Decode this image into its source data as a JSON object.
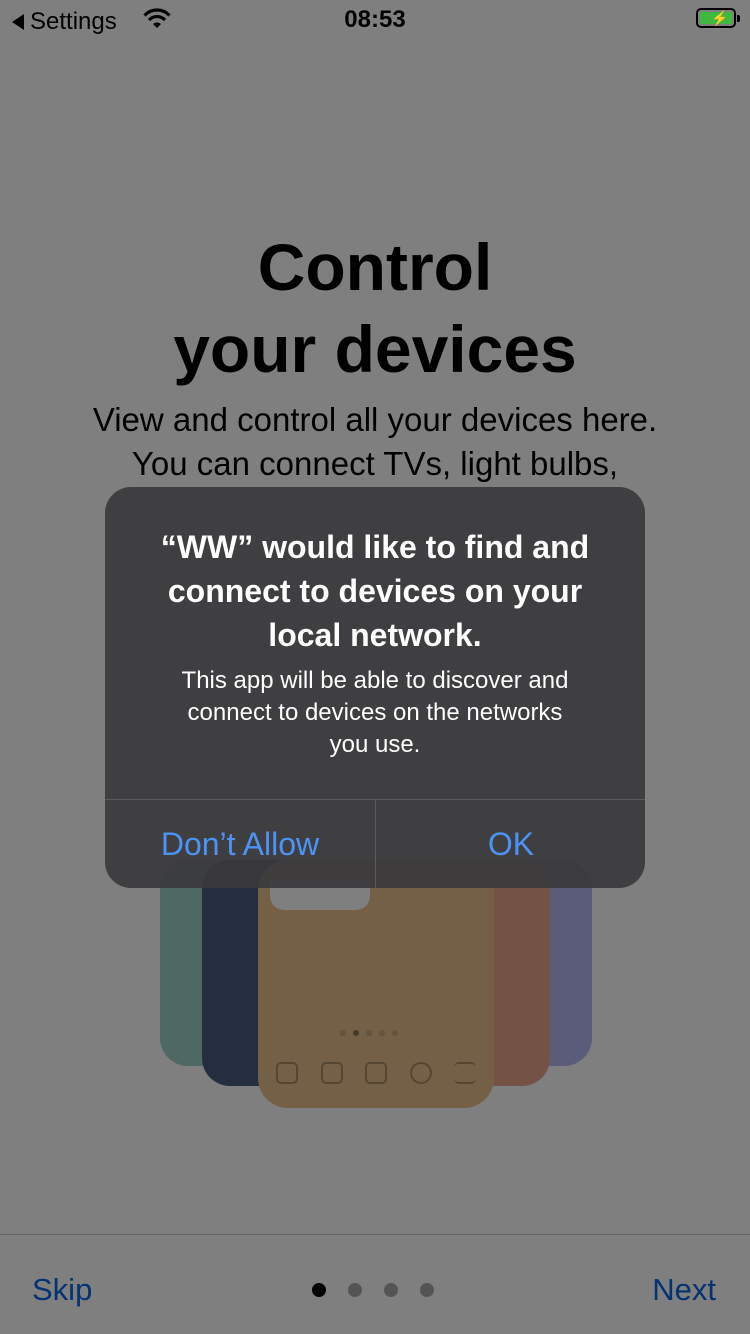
{
  "status_bar": {
    "back_label": "Settings",
    "time": "08:53",
    "battery_color": "#3fb83f",
    "icons": [
      "back-triangle-icon",
      "wifi-icon",
      "battery-charging-icon"
    ]
  },
  "onboarding": {
    "title_lines": [
      "Control",
      "your devices"
    ],
    "subtitle_lines": [
      "View and control all your devices here.",
      "You can connect TVs, light bulbs,"
    ],
    "page_count": 4,
    "current_page": 1
  },
  "bottom_bar": {
    "skip_label": "Skip",
    "next_label": "Next",
    "accent_color": "#0a64e0"
  },
  "alert": {
    "title_lines": [
      "“WW” would like to find and",
      "connect to devices on your",
      "local network."
    ],
    "message_lines": [
      "This app will be able to discover and",
      "connect to devices on the networks",
      "you use."
    ],
    "deny_label": "Don’t Allow",
    "ok_label": "OK",
    "button_color": "#4c93f5"
  }
}
